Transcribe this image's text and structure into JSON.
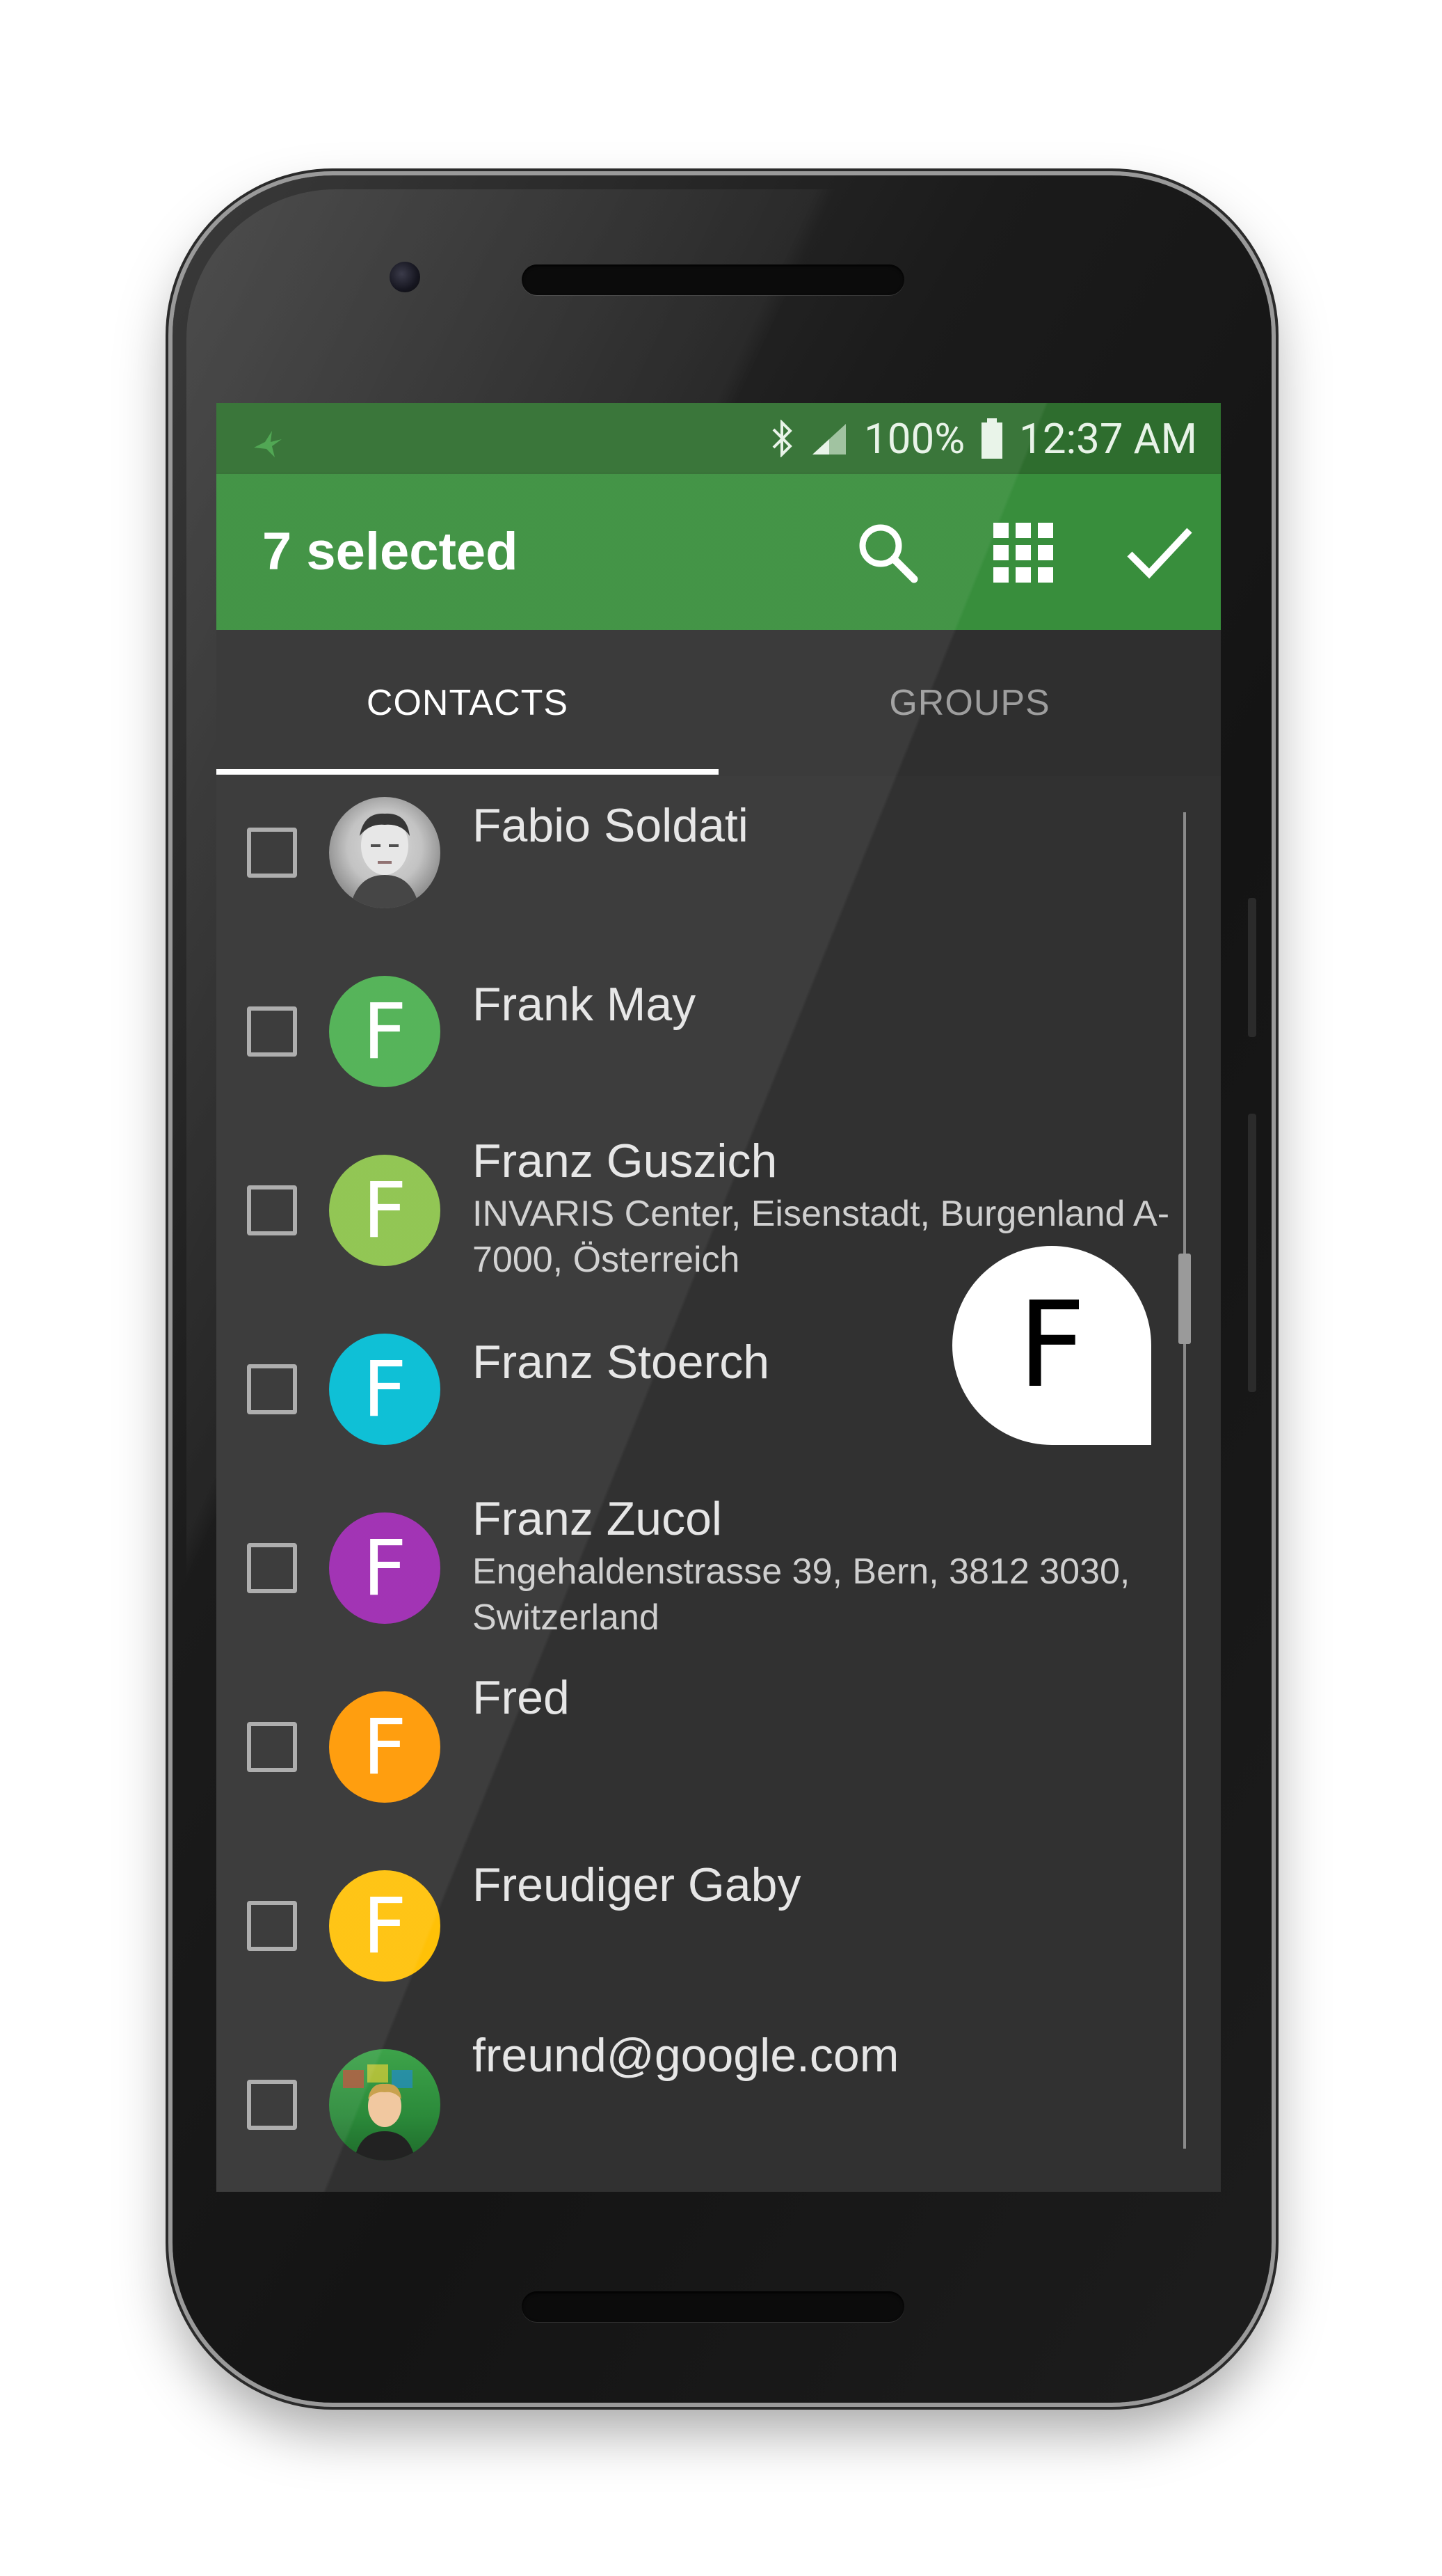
{
  "status_bar": {
    "battery": "100%",
    "time": "12:37 AM"
  },
  "toolbar": {
    "title": "7 selected"
  },
  "tabs": [
    {
      "label": "CONTACTS"
    },
    {
      "label": "GROUPS"
    }
  ],
  "contacts": [
    {
      "name": "Fabio Soldati",
      "address": "",
      "avatar_letter": "",
      "avatar_type": "photo"
    },
    {
      "name": "Frank May",
      "address": "",
      "avatar_letter": "F",
      "avatar_color": "#4caf50"
    },
    {
      "name": "Franz Guszich",
      "address": "INVARIS Center, Eisenstadt, Burgenland A-7000, Österreich",
      "avatar_letter": "F",
      "avatar_color": "#8bc34a"
    },
    {
      "name": "Franz Stoerch",
      "address": "",
      "avatar_letter": "F",
      "avatar_color": "#00bcd4"
    },
    {
      "name": "Franz Zucol",
      "address": "Engehaldenstrasse 39, Bern, 3812 3030, Switzerland",
      "avatar_letter": "F",
      "avatar_color": "#9c27b0"
    },
    {
      "name": "Fred",
      "address": "",
      "avatar_letter": "F",
      "avatar_color": "#ff9800"
    },
    {
      "name": "Freudiger Gaby",
      "address": "",
      "avatar_letter": "F",
      "avatar_color": "#ffc107"
    },
    {
      "name": "freund@google.com",
      "address": "",
      "avatar_letter": "",
      "avatar_type": "photo"
    }
  ],
  "fast_scroll": {
    "letter": "F"
  },
  "colors": {
    "status_bar": "#2e6d2e",
    "toolbar": "#388e3c",
    "background": "#313131"
  }
}
